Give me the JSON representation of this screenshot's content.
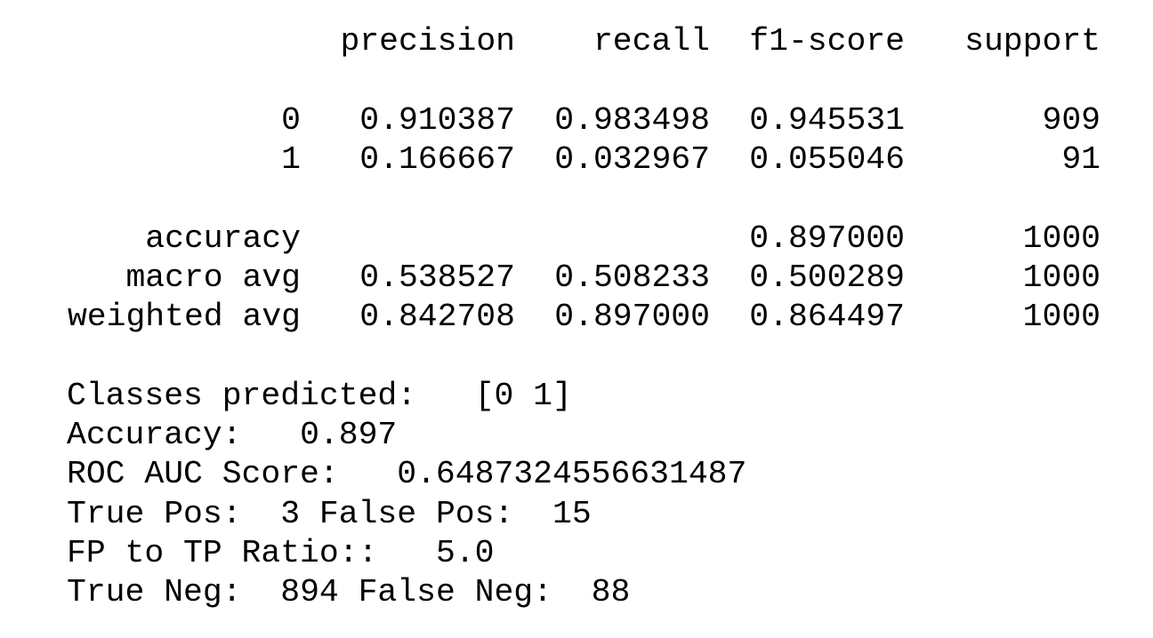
{
  "report": {
    "headers": {
      "precision": "precision",
      "recall": "recall",
      "f1": "f1-score",
      "support": "support"
    },
    "rows": [
      {
        "label": "0",
        "precision": "0.910387",
        "recall": "0.983498",
        "f1": "0.945531",
        "support": "909"
      },
      {
        "label": "1",
        "precision": "0.166667",
        "recall": "0.032967",
        "f1": "0.055046",
        "support": "91"
      },
      {
        "label": "accuracy",
        "precision": "",
        "recall": "",
        "f1": "0.897000",
        "support": "1000"
      },
      {
        "label": "macro avg",
        "precision": "0.538527",
        "recall": "0.508233",
        "f1": "0.500289",
        "support": "1000"
      },
      {
        "label": "weighted avg",
        "precision": "0.842708",
        "recall": "0.897000",
        "f1": "0.864497",
        "support": "1000"
      }
    ]
  },
  "summary": {
    "classes_label": "Classes predicted:",
    "classes_value": "[0 1]",
    "accuracy_label": "Accuracy:",
    "accuracy_value": "0.897",
    "roc_label": "ROC AUC Score:",
    "roc_value": "0.6487324556631487",
    "true_pos_label": "True Pos:",
    "true_pos_value": "3",
    "false_pos_label": "False Pos:",
    "false_pos_value": "15",
    "ratio_label": "FP to TP Ratio::",
    "ratio_value": "5.0",
    "true_neg_label": "True Neg:",
    "true_neg_value": "894",
    "false_neg_label": "False Neg:",
    "false_neg_value": "88"
  }
}
